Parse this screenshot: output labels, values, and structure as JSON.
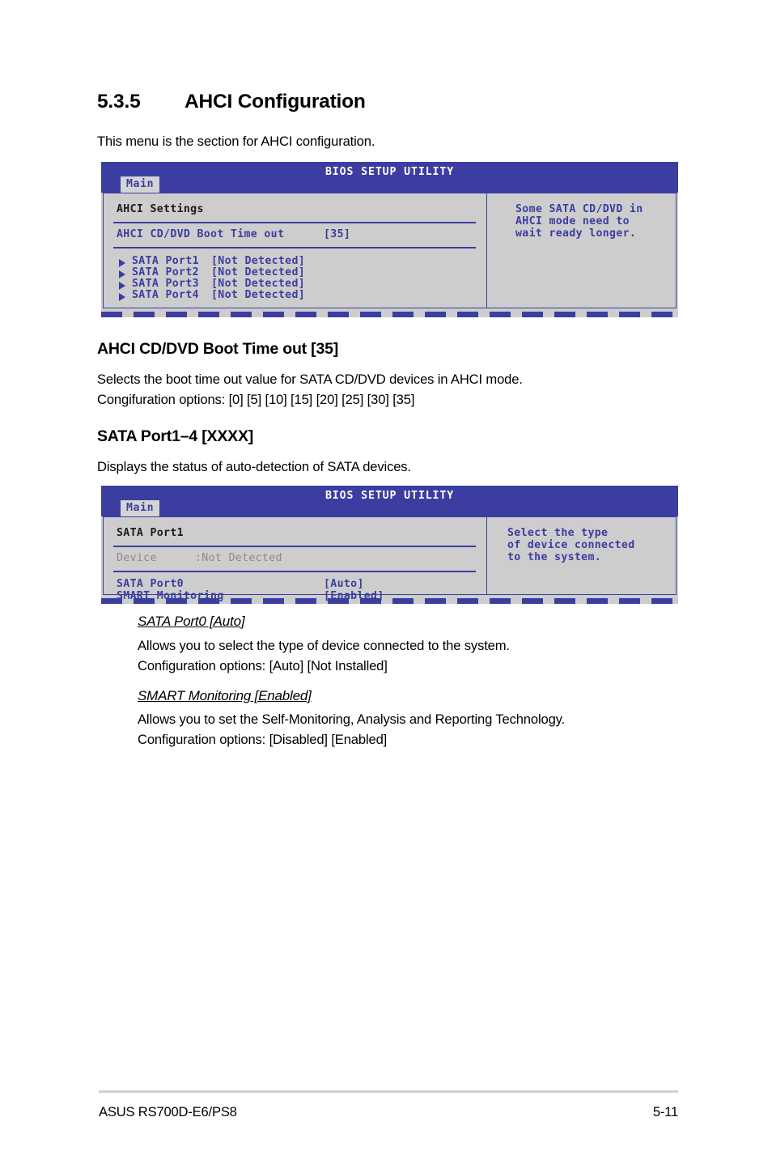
{
  "section": {
    "number": "5.3.5",
    "title": "AHCI Configuration",
    "intro": "This menu is the section for AHCI configuration."
  },
  "bios_screen_1": {
    "title": "BIOS SETUP UTILITY",
    "tab": "Main",
    "group_label": "AHCI Settings",
    "setting_label": "AHCI CD/DVD Boot Time out",
    "setting_value": "[35]",
    "ports": [
      {
        "label": "SATA Port1",
        "value": "[Not Detected]"
      },
      {
        "label": "SATA Port2",
        "value": "[Not Detected]"
      },
      {
        "label": "SATA Port3",
        "value": "[Not Detected]"
      },
      {
        "label": "SATA Port4",
        "value": "[Not Detected]"
      }
    ],
    "help_lines": [
      "Some SATA CD/DVD in",
      "AHCI mode need to",
      "wait ready longer."
    ]
  },
  "subsection_1": {
    "heading": "AHCI CD/DVD Boot Time out [35]",
    "line1": "Selects the boot time out value for SATA CD/DVD devices in AHCI mode.",
    "line2": "Congifuration options: [0] [5] [10] [15] [20] [25] [30] [35]"
  },
  "subsection_2": {
    "heading": "SATA Port1–4 [XXXX]",
    "line1": "Displays the status of auto-detection of SATA devices."
  },
  "bios_screen_2": {
    "title": "BIOS SETUP UTILITY",
    "tab": "Main",
    "group_label": "SATA Port1",
    "device_label": "Device",
    "device_value": ":Not Detected",
    "settings": [
      {
        "label": "SATA Port0",
        "value": "[Auto]"
      },
      {
        "label": "SMART Monitoring",
        "value": "[Enabled]"
      }
    ],
    "help_lines": [
      "Select the type",
      "of device connected",
      "to the system."
    ]
  },
  "item_sata_port0": {
    "heading": "SATA Port0 [Auto]",
    "line1": "Allows you to select the type of device connected to the system.",
    "line2": "Configuration options: [Auto] [Not Installed]"
  },
  "item_smart_monitoring": {
    "heading": "SMART Monitoring [Enabled]",
    "line1": "Allows you to set the Self-Monitoring, Analysis and Reporting Technology.",
    "line2": "Configuration options: [Disabled] [Enabled]"
  },
  "footer": {
    "product": "ASUS RS700D-E6/PS8",
    "page": "5-11"
  },
  "colors": {
    "bios_blue": "#3b3ea0",
    "bios_bg": "#cdcdcd",
    "tab_bg": "#d4d4d4",
    "grey_text": "#8a8a8a"
  }
}
